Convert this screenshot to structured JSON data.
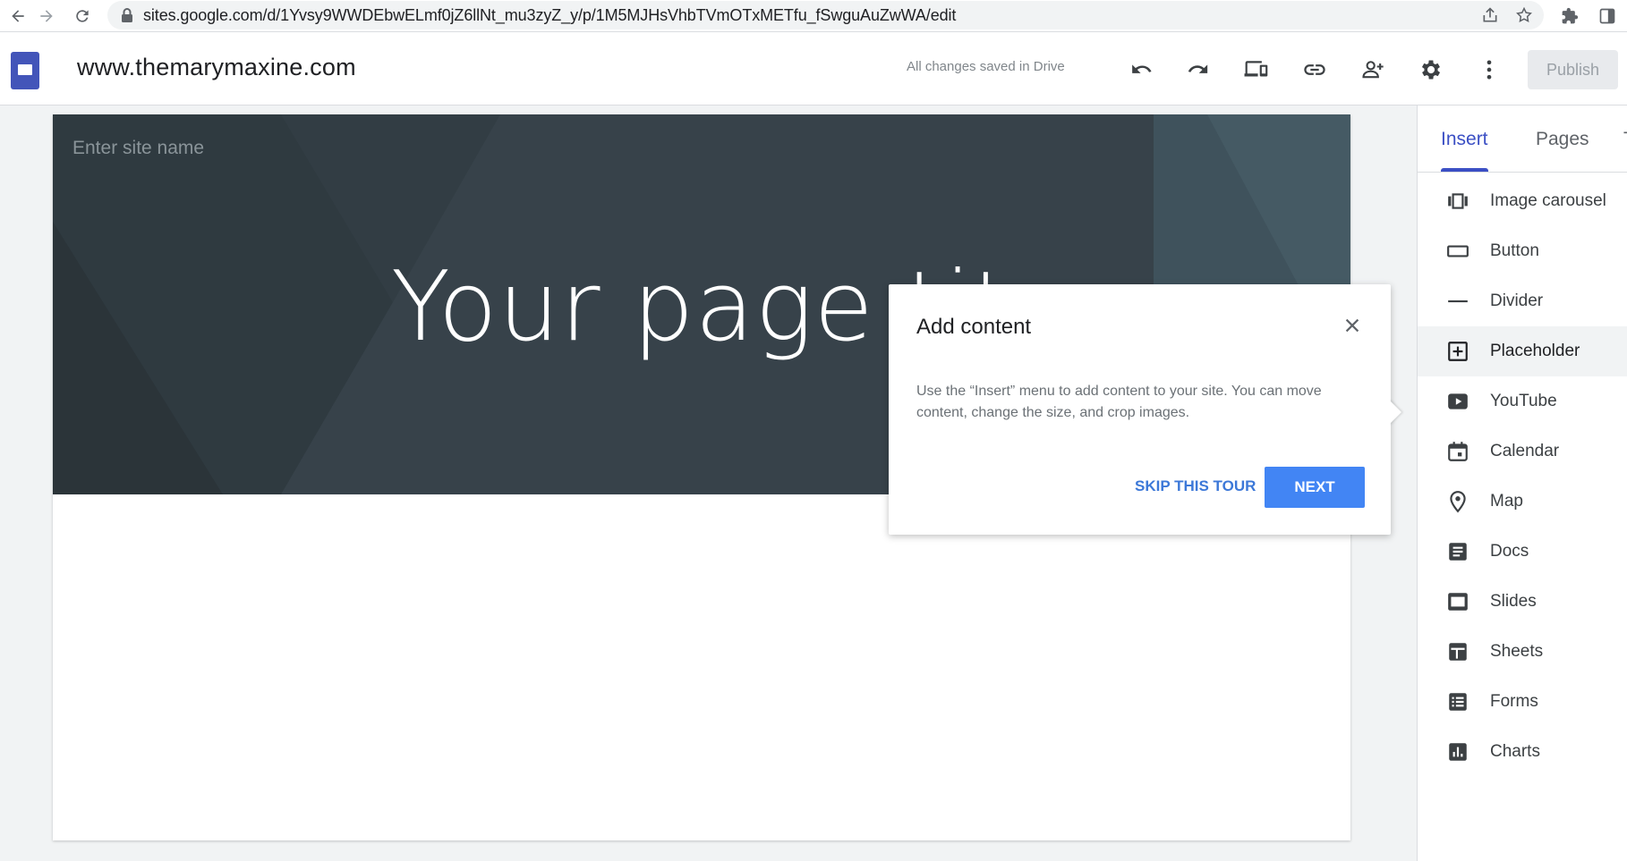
{
  "browser": {
    "url": "sites.google.com/d/1Yvsy9WWDEbwELmf0jZ6llNt_mu3zyZ_y/p/1M5MJHsVhbTVmOTxMETfu_fSwguAuZwWA/edit",
    "icons": [
      "back-arrow-icon",
      "forward-arrow-icon",
      "reload-icon",
      "lock-icon",
      "share-icon",
      "star-icon",
      "extensions-icon",
      "sidebar-icon"
    ]
  },
  "header": {
    "site_title": "www.themarymaxine.com",
    "save_status": "All changes saved in Drive",
    "publish_label": "Publish",
    "icons": [
      "undo-icon",
      "redo-icon",
      "preview-devices-icon",
      "link-icon",
      "add-person-icon",
      "gear-icon",
      "more-vert-icon"
    ]
  },
  "canvas": {
    "site_name_placeholder": "Enter site name",
    "page_title": "Your page tit"
  },
  "panel": {
    "tabs": [
      {
        "label": "Insert",
        "active": true
      },
      {
        "label": "Pages",
        "active": false
      }
    ],
    "items": [
      {
        "label": "Image carousel",
        "icon": "carousel-icon"
      },
      {
        "label": "Button",
        "icon": "button-icon"
      },
      {
        "label": "Divider",
        "icon": "divider-icon"
      },
      {
        "label": "Placeholder",
        "icon": "add-box-icon",
        "hover": true
      },
      {
        "label": "YouTube",
        "icon": "youtube-icon"
      },
      {
        "label": "Calendar",
        "icon": "calendar-icon"
      },
      {
        "label": "Map",
        "icon": "map-pin-icon"
      },
      {
        "label": "Docs",
        "icon": "docs-icon"
      },
      {
        "label": "Slides",
        "icon": "slides-icon"
      },
      {
        "label": "Sheets",
        "icon": "sheets-icon"
      },
      {
        "label": "Forms",
        "icon": "forms-icon"
      },
      {
        "label": "Charts",
        "icon": "charts-icon"
      }
    ]
  },
  "dialog": {
    "title": "Add content",
    "body": "Use the “Insert” menu to add content to your site. You can move content, change the size, and crop images.",
    "skip_label": "SKIP THIS TOUR",
    "next_label": "NEXT"
  },
  "colors": {
    "accent": "#3b4fc4",
    "primary_button": "#4285f4",
    "hero_bg": "#37474f"
  }
}
